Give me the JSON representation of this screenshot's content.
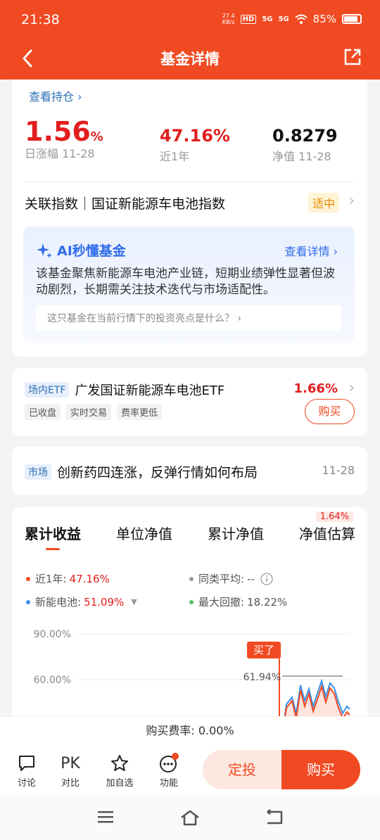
{
  "status_bar": {
    "time": "21:38",
    "net_speed_value": "27.4",
    "net_speed_unit": "KB/s",
    "hd": "HD",
    "signal1": "5G",
    "signal2": "5G",
    "battery": "85%"
  },
  "nav": {
    "title": "基金详情"
  },
  "summary": {
    "holdings_link": "查看持仓 ›",
    "daily_change": "1.56",
    "daily_change_unit": "%",
    "daily_label": "日涨幅 11-28",
    "year_change": "47.16%",
    "year_label": "近1年",
    "nav_value": "0.8279",
    "nav_label": "净值 11-28"
  },
  "index": {
    "text": "关联指数｜国证新能源车电池指数",
    "rating": "适中"
  },
  "ai": {
    "title": "AI秒懂基金",
    "more": "查看详情 ›",
    "text": "该基金聚焦新能源车电池产业链，短期业绩弹性显著但波动剧烈，长期需关注技术迭代与市场适配性。",
    "question": "这只基金在当前行情下的投资亮点是什么？ ›"
  },
  "etf": {
    "tag": "场内ETF",
    "name": "广发国证新能源车电池ETF",
    "change": "1.66%",
    "tags": [
      "已收盘",
      "实时交易",
      "费率更低"
    ],
    "buy": "购买"
  },
  "news": {
    "tag": "市场",
    "title": "创新药四连涨，反弹行情如何布局",
    "date": "11-28"
  },
  "performance": {
    "tabs": [
      "累计收益",
      "单位净值",
      "累计净值",
      "净值估算"
    ],
    "estimate_badge": "1.64%",
    "legend": {
      "year_label": "近1年:",
      "year_value": "47.16%",
      "peer_label": "同类平均:",
      "peer_value": "--",
      "index_label": "新能电池:",
      "index_value": "51.09%",
      "drawdown_label": "最大回撤:",
      "drawdown_value": "18.22%"
    },
    "colors": {
      "fund": "#f04a22",
      "index": "#3a8ee6",
      "peer": "#999999",
      "drawdown": "#4cc36b"
    }
  },
  "chart_data": {
    "type": "line",
    "y_ticks": [
      "90.00%",
      "60.00%"
    ],
    "annotation_buy": "买了",
    "annotation_value": "61.94%"
  },
  "fee": {
    "text": "购买费率: 0.00%"
  },
  "bottom": {
    "items": [
      {
        "icon": "chat-icon",
        "label": "讨论"
      },
      {
        "icon": "pk-icon",
        "label": "对比",
        "glyph": "PK"
      },
      {
        "icon": "star-icon",
        "label": "加自选"
      },
      {
        "icon": "more-icon",
        "label": "功能"
      }
    ],
    "plan_label": "定投",
    "buy_label": "购买"
  }
}
